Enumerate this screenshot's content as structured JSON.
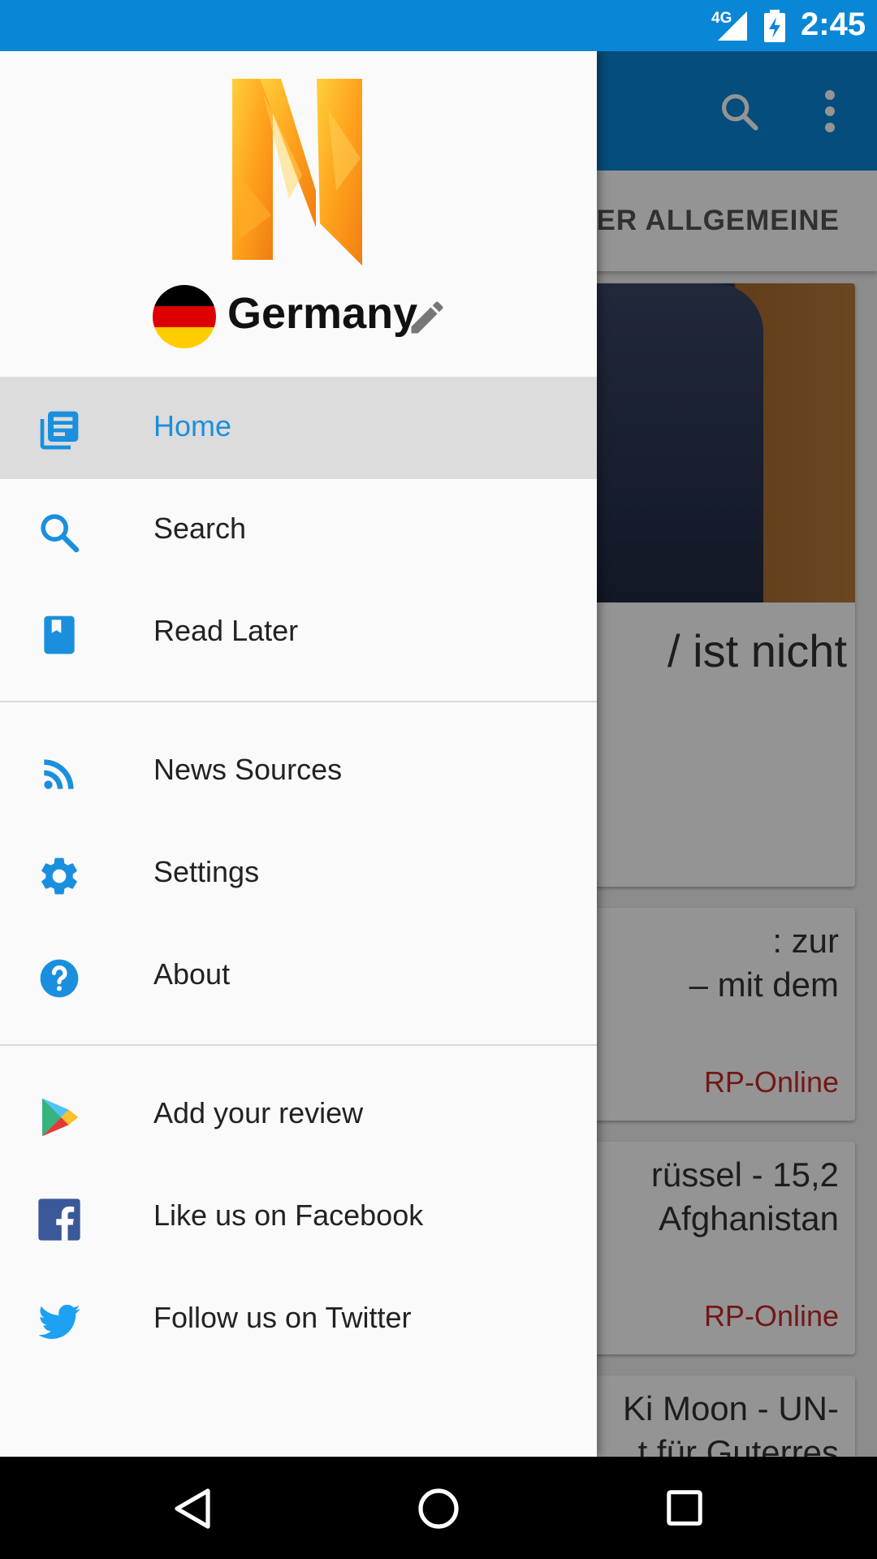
{
  "status_bar": {
    "network": "4G",
    "time": "2:45"
  },
  "background": {
    "tab_label": "RTER ALLGEMEINE",
    "cards": [
      {
        "headline": "/ ist nicht",
        "snippet": [],
        "source": ""
      },
      {
        "headline": "",
        "snippet": ": zur",
        "snippet2": "– mit dem",
        "source": "RP-Online"
      },
      {
        "headline": "",
        "snippet": "rüssel - 15,2",
        "snippet2": "Afghanistan",
        "source": "RP-Online"
      },
      {
        "headline": "",
        "snippet": "Ki Moon - UN-",
        "snippet2": "t für Guterres",
        "source": ""
      }
    ]
  },
  "drawer": {
    "country": "Germany",
    "menu": [
      {
        "id": "home",
        "label": "Home",
        "icon": "news-icon",
        "active": true
      },
      {
        "id": "search",
        "label": "Search",
        "icon": "search-icon"
      },
      {
        "id": "read-later",
        "label": "Read Later",
        "icon": "bookmark-icon"
      },
      {
        "id": "news-sources",
        "label": "News Sources",
        "icon": "rss-icon"
      },
      {
        "id": "settings",
        "label": "Settings",
        "icon": "gear-icon"
      },
      {
        "id": "about",
        "label": "About",
        "icon": "help-icon"
      },
      {
        "id": "review",
        "label": "Add your review",
        "icon": "play-store-icon"
      },
      {
        "id": "facebook",
        "label": "Like us on Facebook",
        "icon": "facebook-icon"
      },
      {
        "id": "twitter",
        "label": "Follow us on Twitter",
        "icon": "twitter-icon"
      }
    ]
  },
  "colors": {
    "primary": "#0a86d6",
    "accent": "#1a8fde",
    "source_red": "#c62828"
  }
}
